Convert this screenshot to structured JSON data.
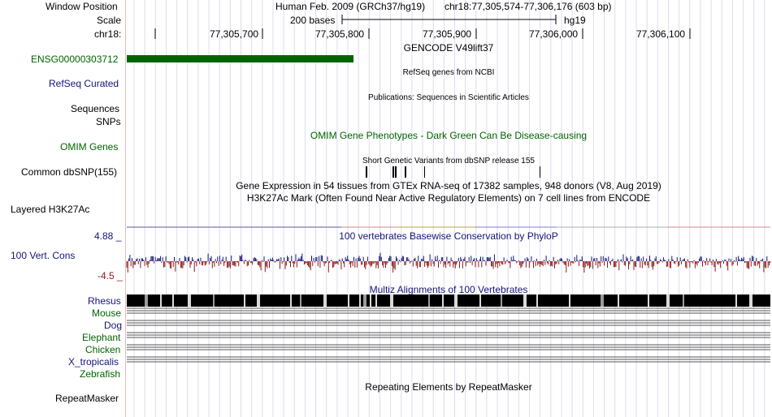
{
  "header": {
    "window_position_label": "Window Position",
    "scale_label": "Scale",
    "chrom_label": "chr18:",
    "assembly_text": "Human Feb. 2009 (GRCh37/hg19)",
    "position_text": "chr18:77,305,574-77,306,176 (603 bp)",
    "scale_text": "200 bases",
    "scale_db": "hg19",
    "ruler_ticks": [
      "77,305,700",
      "77,305,800",
      "77,305,900",
      "77,306,000",
      "77,306,100"
    ]
  },
  "tracks": {
    "gencode": {
      "title": "GENCODE V49lift37",
      "item_label": "ENSG00000303712",
      "color": "#006400"
    },
    "refseq": {
      "title": "RefSeq genes from NCBI",
      "label": "RefSeq Curated"
    },
    "publications": {
      "title": "Publications: Sequences in Scientific Articles",
      "label1": "Sequences",
      "label2": "SNPs"
    },
    "omim": {
      "title": "OMIM Gene Phenotypes - Dark Green Can Be Disease-causing",
      "label": "OMIM Genes",
      "color": "#006400"
    },
    "dbsnp": {
      "title": "Short Genetic Variants from dbSNP release 155",
      "label": "Common dbSNP(155)"
    },
    "gtex": {
      "title": "Gene Expression in 54 tissues from GTEx RNA-seq of 17382 samples, 948 donors (V8, Aug 2019)"
    },
    "h3k27ac": {
      "title": "H3K27Ac Mark (Often Found Near Active Regulatory Elements) on 7 cell lines from ENCODE",
      "label": "Layered H3K27Ac"
    },
    "conservation": {
      "title": "100 vertebrates Basewise Conservation by PhyloP",
      "label": "100 Vert. Cons",
      "max_label": "4.88 _",
      "min_label": "-4.5 _",
      "positive_color": "#141478",
      "negative_color": "#8b1a1a"
    },
    "multiz": {
      "title": "Multiz Alignments of 100 Vertebrates",
      "species": [
        {
          "name": "Rhesus",
          "color": "#141478"
        },
        {
          "name": "Mouse",
          "color": "#006400"
        },
        {
          "name": "Dog",
          "color": "#141478"
        },
        {
          "name": "Elephant",
          "color": "#006400"
        },
        {
          "name": "Chicken",
          "color": "#006400"
        },
        {
          "name": "X_tropicalis",
          "color": "#141478"
        },
        {
          "name": "Zebrafish",
          "color": "#006400"
        }
      ]
    },
    "repeatmasker": {
      "title": "Repeating Elements by RepeatMasker",
      "label": "RepeatMasker"
    }
  },
  "colors": {
    "label_blue": "#141478",
    "label_green": "#006400",
    "grid_line": "#dcdcf0",
    "divider": "#f2b8b8"
  }
}
